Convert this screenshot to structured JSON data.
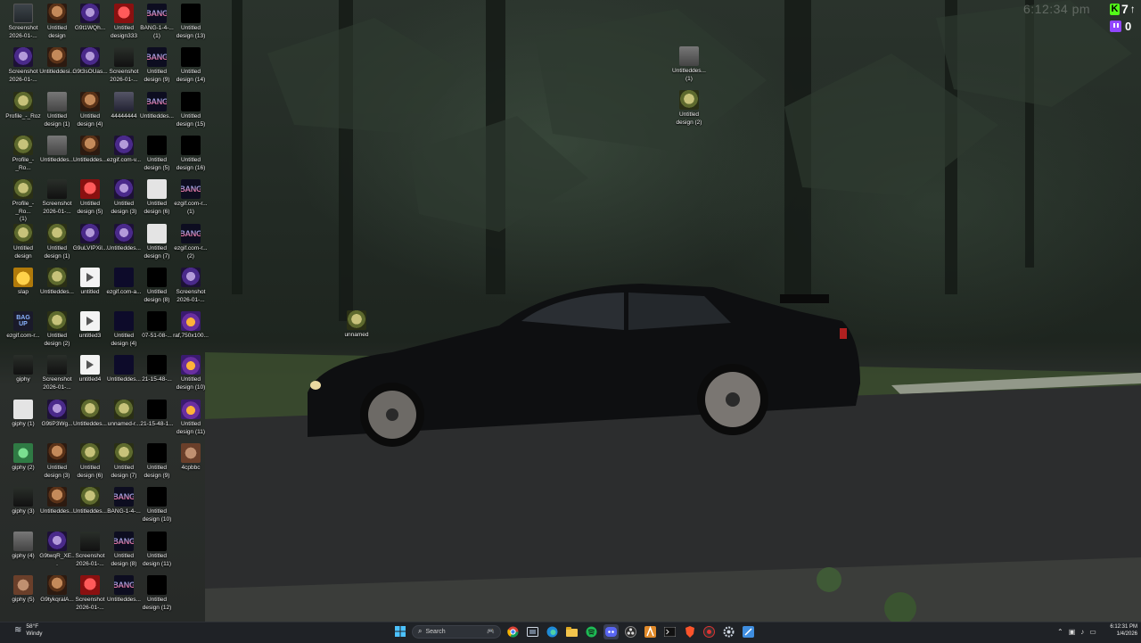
{
  "desktop": {
    "icons": [
      {
        "label": "Screenshot\n2026-01-...",
        "thumb": "t-screen"
      },
      {
        "label": "Untitled\ndesign",
        "thumb": "t-face"
      },
      {
        "label": "G9t1WQh...",
        "thumb": "t-purple"
      },
      {
        "label": "Untitled\ndesign333",
        "thumb": "t-red"
      },
      {
        "label": "BANG-1-4-...\n(1)",
        "thumb": "t-bang"
      },
      {
        "label": "Untitled\ndesign (13)",
        "thumb": "t-black"
      },
      {
        "label": "Screenshot\n2026-01-...",
        "thumb": "t-purple"
      },
      {
        "label": "Untitleddesi...",
        "thumb": "t-face"
      },
      {
        "label": "G9t3sOUas...",
        "thumb": "t-purple"
      },
      {
        "label": "Screenshot\n2026-01-...",
        "thumb": "t-dark"
      },
      {
        "label": "Untitled\ndesign (9)",
        "thumb": "t-bang"
      },
      {
        "label": "Untitled\ndesign (14)",
        "thumb": "t-black"
      },
      {
        "label": "Profile_-_Roz",
        "thumb": "t-frog"
      },
      {
        "label": "Untitled\ndesign (1)",
        "thumb": "t-gray"
      },
      {
        "label": "Untitled\ndesign (4)",
        "thumb": "t-face"
      },
      {
        "label": "44444444",
        "thumb": "t-car"
      },
      {
        "label": "Untitleddes...",
        "thumb": "t-bang"
      },
      {
        "label": "Untitled\ndesign (15)",
        "thumb": "t-black"
      },
      {
        "label": "Profile_-_Ro...",
        "thumb": "t-frog"
      },
      {
        "label": "Untitleddes...",
        "thumb": "t-gray"
      },
      {
        "label": "Untitleddes...",
        "thumb": "t-face"
      },
      {
        "label": "ezgif.com-v...",
        "thumb": "t-purple"
      },
      {
        "label": "Untitled\ndesign (5)",
        "thumb": "t-black"
      },
      {
        "label": "Untitled\ndesign (16)",
        "thumb": "t-black"
      },
      {
        "label": "Profile_-_Ro...\n(1)",
        "thumb": "t-frog"
      },
      {
        "label": "Screenshot\n2026-01-...",
        "thumb": "t-dark"
      },
      {
        "label": "Untitled\ndesign (5)",
        "thumb": "t-red"
      },
      {
        "label": "Untitled\ndesign (3)",
        "thumb": "t-purple"
      },
      {
        "label": "Untitled\ndesign (6)",
        "thumb": "t-white"
      },
      {
        "label": "ezgif.com-r...\n(1)",
        "thumb": "t-bang"
      },
      {
        "label": "Untitled\ndesign",
        "thumb": "t-frog"
      },
      {
        "label": "Untitled\ndesign (1)",
        "thumb": "t-frog"
      },
      {
        "label": "G9uLVIPXil...",
        "thumb": "t-purple"
      },
      {
        "label": "Untitleddes...",
        "thumb": "t-purple"
      },
      {
        "label": "Untitled\ndesign (7)",
        "thumb": "t-white"
      },
      {
        "label": "ezgif.com-r...\n(2)",
        "thumb": "t-bang"
      },
      {
        "label": "slap",
        "thumb": "t-gold"
      },
      {
        "label": "Untitleddes...",
        "thumb": "t-frog"
      },
      {
        "label": "untitled",
        "thumb": "t-doc"
      },
      {
        "label": "ezgif.com-a...",
        "thumb": "t-navy"
      },
      {
        "label": "Untitled\ndesign (8)",
        "thumb": "t-black"
      },
      {
        "label": "Screenshot\n2026-01-...",
        "thumb": "t-purple"
      },
      {
        "label": "ezgif.com-r...",
        "thumb": "t-bag"
      },
      {
        "label": "Untitled\ndesign (2)",
        "thumb": "t-frog"
      },
      {
        "label": "untitled3",
        "thumb": "t-doc"
      },
      {
        "label": "Untitled\ndesign (4)",
        "thumb": "t-navy"
      },
      {
        "label": "07-51-08-...",
        "thumb": "t-black"
      },
      {
        "label": "raf,750x100...",
        "thumb": "t-taco"
      },
      {
        "label": "giphy",
        "thumb": "t-dark"
      },
      {
        "label": "Screenshot\n2026-01-...",
        "thumb": "t-dark"
      },
      {
        "label": "untitled4",
        "thumb": "t-doc"
      },
      {
        "label": "Untitleddes...",
        "thumb": "t-navy"
      },
      {
        "label": "21-15-48-...",
        "thumb": "t-black"
      },
      {
        "label": "Untitled\ndesign (10)",
        "thumb": "t-taco"
      },
      {
        "label": "giphy (1)",
        "thumb": "t-white"
      },
      {
        "label": "G9tiP3Wg...",
        "thumb": "t-purple"
      },
      {
        "label": "Untitleddes...",
        "thumb": "t-frog"
      },
      {
        "label": "unnamed-r...",
        "thumb": "t-frog"
      },
      {
        "label": "21-15-48-1...",
        "thumb": "t-black"
      },
      {
        "label": "Untitled\ndesign (11)",
        "thumb": "t-taco"
      },
      {
        "label": "giphy (2)",
        "thumb": "t-green"
      },
      {
        "label": "Untitled\ndesign (3)",
        "thumb": "t-face"
      },
      {
        "label": "Untitled\ndesign (6)",
        "thumb": "t-frog"
      },
      {
        "label": "Untitled\ndesign (7)",
        "thumb": "t-frog"
      },
      {
        "label": "Untitled\ndesign (9)",
        "thumb": "t-black"
      },
      {
        "label": "4cpbbc",
        "thumb": "t-brown"
      },
      {
        "label": "giphy (3)",
        "thumb": "t-dark"
      },
      {
        "label": "Untitleddes...",
        "thumb": "t-face"
      },
      {
        "label": "Untitleddes...",
        "thumb": "t-frog"
      },
      {
        "label": "BANG-1-4-...",
        "thumb": "t-bang"
      },
      {
        "label": "Untitled\ndesign (10)",
        "thumb": "t-black"
      },
      {
        "label": "",
        "thumb": ""
      },
      {
        "label": "giphy (4)",
        "thumb": "t-gray"
      },
      {
        "label": "G9twqR_XE...",
        "thumb": "t-purple"
      },
      {
        "label": "Screenshot\n2026-01-...",
        "thumb": "t-dark"
      },
      {
        "label": "Untitled\ndesign (8)",
        "thumb": "t-bang"
      },
      {
        "label": "Untitled\ndesign (11)",
        "thumb": "t-black"
      },
      {
        "label": "",
        "thumb": ""
      },
      {
        "label": "giphy (5)",
        "thumb": "t-brown"
      },
      {
        "label": "G9tykqralA...",
        "thumb": "t-face"
      },
      {
        "label": "Screenshot\n2026-01-...",
        "thumb": "t-red"
      },
      {
        "label": "Untitleddes...",
        "thumb": "t-bang"
      },
      {
        "label": "Untitled\ndesign (12)",
        "thumb": "t-black"
      },
      {
        "label": "",
        "thumb": ""
      }
    ],
    "loose_icons": [
      {
        "label": "Untitleddes...\n(1)",
        "thumb": "t-gray"
      },
      {
        "label": "Untitled\ndesign (2)",
        "thumb": "t-frog"
      },
      {
        "label": "unnamed",
        "thumb": "t-frog"
      }
    ],
    "bang_text": "BANG",
    "bag_text": "BAG\nUP"
  },
  "overlay": {
    "clock": "6:12:34 pm",
    "kick_count": "7",
    "twitch_count": "0",
    "kick_color": "#53fc18",
    "twitch_color": "#9146ff"
  },
  "taskbar": {
    "weather_temp": "58°F",
    "weather_desc": "Windy",
    "search_placeholder": "Search",
    "apps": [
      "windows-start-icon",
      "search",
      "chrome-icon",
      "task-view-icon",
      "edge-icon",
      "file-explorer-icon",
      "spotify-icon",
      "discord-icon",
      "obs-icon",
      "app-a-icon",
      "terminal-icon",
      "brave-icon",
      "app-red-icon",
      "settings-icon",
      "snipping-icon"
    ],
    "time": "6:12:31 PM",
    "date": "1/4/2026"
  }
}
